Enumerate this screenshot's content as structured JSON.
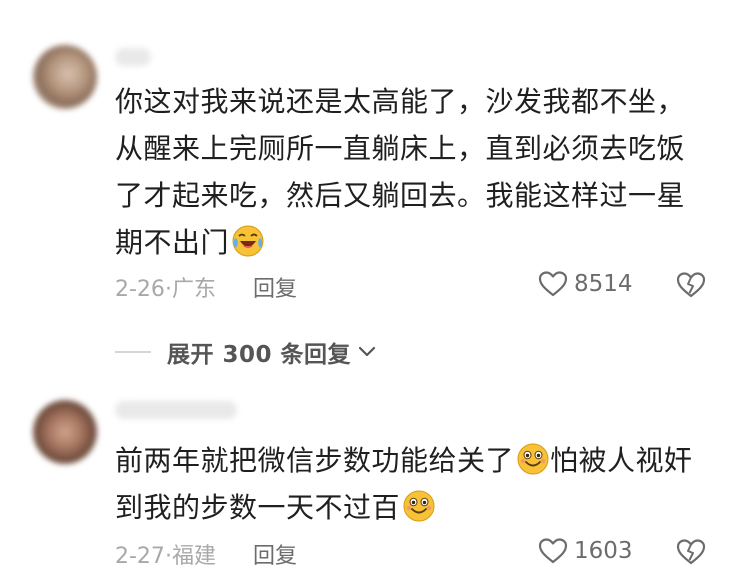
{
  "comments": [
    {
      "username": "",
      "lines": [
        "你这对我来说还是太高能了，沙发我都不坐，",
        "从醒来上完厕所一直躺床上，直到必须去吃饭",
        "了才起来吃，然后又躺回去。我能这样过一星",
        "期不出门"
      ],
      "emoji": "laughing-crying-emoji",
      "date": "2-26",
      "location": "广东",
      "reply_label": "回复",
      "likes": "8514"
    },
    {
      "username": "",
      "lines": [
        "前两年就把微信步数功能给关了",
        "怕被人视奸",
        "到我的步数一天不过百"
      ],
      "emoji": "grinning-emoji",
      "date": "2-27",
      "location": "福建",
      "reply_label": "回复",
      "likes": "1603"
    }
  ],
  "expand_replies": {
    "label": "展开 300 条回复"
  },
  "colors": {
    "text": "#1f1f1f",
    "meta": "#a8a8a8",
    "action": "#6c6c6c",
    "emoji_face": "#f7c236"
  }
}
